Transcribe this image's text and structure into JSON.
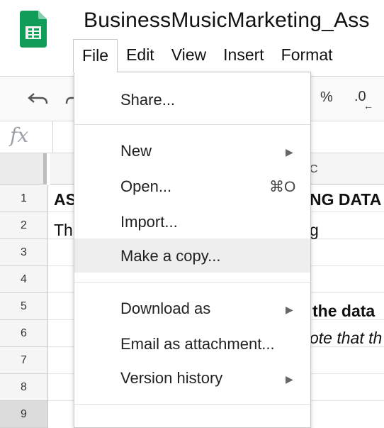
{
  "app": {
    "doc_title": "BusinessMusicMarketing_Ass"
  },
  "menubar": {
    "items": [
      "File",
      "Edit",
      "View",
      "Insert",
      "Format"
    ],
    "active_index": 0
  },
  "toolbar": {
    "percent": "%",
    "decimal": ".0",
    "decimal_arrow": "←"
  },
  "formula": {
    "fx_label": "fx"
  },
  "grid": {
    "visible_column": "C",
    "rows": [
      "1",
      "2",
      "3",
      "4",
      "5",
      "6",
      "7",
      "8",
      "9"
    ],
    "cells": {
      "r1_left": "AS",
      "r1_right": "NG DATA",
      "r2_left": "Th",
      "r2_right": "g",
      "r5_right": "the data",
      "r6_right": "ote that th"
    }
  },
  "file_menu": {
    "share": "Share...",
    "new": "New",
    "open": "Open...",
    "open_shortcut": "⌘O",
    "import": "Import...",
    "make_copy": "Make a copy...",
    "download_as": "Download as",
    "email_attachment": "Email as attachment...",
    "version_history": "Version history",
    "highlighted": "Make a copy..."
  },
  "colors": {
    "sheets_green": "#0f9d58",
    "sheets_green_light": "#87ceac",
    "hover": "#eeeeee"
  },
  "icons": [
    "sheets-logo-icon",
    "undo-icon",
    "redo-icon",
    "submenu-arrow-icon"
  ]
}
